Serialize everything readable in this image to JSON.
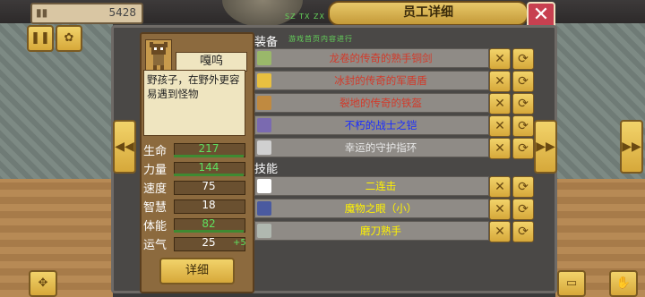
{
  "header": {
    "money": "5428",
    "title": "员工详细",
    "scroll_text_1": "SZ TX ZX NZ LQQ STRDZ",
    "scroll_text_2": "游戏首页内容进行"
  },
  "employee": {
    "name": "嘎呜",
    "description": "野孩子，在野外更容易遇到怪物",
    "stats": [
      {
        "label": "生命",
        "value": "217",
        "highlight": true
      },
      {
        "label": "力量",
        "value": "144",
        "highlight": true
      },
      {
        "label": "速度",
        "value": "75",
        "highlight": false
      },
      {
        "label": "智慧",
        "value": "18",
        "highlight": false
      },
      {
        "label": "体能",
        "value": "82",
        "highlight": true
      },
      {
        "label": "运气",
        "value": "25",
        "highlight": false,
        "bonus": "+5"
      }
    ],
    "detail_button": "详细"
  },
  "equipment": {
    "title": "装备",
    "items": [
      {
        "name": "龙卷的传奇的熟手铜剑",
        "color": "#d23a2a",
        "icon": "sword-icon"
      },
      {
        "name": "冰封的传奇的军盾盾",
        "color": "#d23a2a",
        "icon": "shield-icon"
      },
      {
        "name": "裂地的传奇的铁盔",
        "color": "#d23a2a",
        "icon": "helmet-icon"
      },
      {
        "name": "不朽的战士之铠",
        "color": "#1a2cff",
        "icon": "armor-icon"
      },
      {
        "name": "幸运的守护指环",
        "color": "#e8e8e8",
        "icon": "ring-icon"
      }
    ]
  },
  "skills": {
    "title": "技能",
    "items": [
      {
        "name": "二连击",
        "color": "#fff200",
        "icon": "slash-icon"
      },
      {
        "name": "魔物之眼（小）",
        "color": "#fff200",
        "icon": "eye-icon"
      },
      {
        "name": "磨刀熟手",
        "color": "#fff200",
        "icon": "blade-icon"
      }
    ]
  },
  "colors": {
    "panel_gold": "#e8c86a",
    "close_red": "#c84050"
  }
}
